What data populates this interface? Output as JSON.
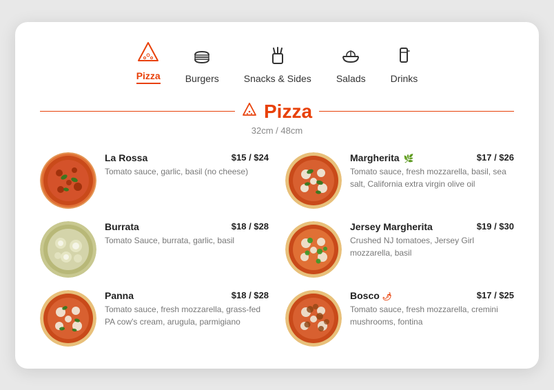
{
  "nav": {
    "items": [
      {
        "id": "pizza",
        "label": "Pizza",
        "icon": "pizza",
        "active": true
      },
      {
        "id": "burgers",
        "label": "Burgers",
        "icon": "burger",
        "active": false
      },
      {
        "id": "snacks",
        "label": "Snacks & Sides",
        "icon": "fries",
        "active": false
      },
      {
        "id": "salads",
        "label": "Salads",
        "icon": "salad",
        "active": false
      },
      {
        "id": "drinks",
        "label": "Drinks",
        "icon": "drink",
        "active": false
      }
    ]
  },
  "section": {
    "title": "Pizza",
    "subtitle": "32cm / 48cm"
  },
  "menu_items": [
    {
      "id": "la-rossa",
      "name": "La Rossa",
      "price": "$15 / $24",
      "desc": "Tomato sauce, garlic, basil (no cheese)",
      "badge": "",
      "col": 0
    },
    {
      "id": "margherita",
      "name": "Margherita",
      "price": "$17 / $26",
      "desc": "Tomato sauce, fresh mozzarella, basil, sea salt, California extra virgin olive oil",
      "badge": "veg",
      "col": 1
    },
    {
      "id": "burrata",
      "name": "Burrata",
      "price": "$18 / $28",
      "desc": "Tomato Sauce, burrata, garlic, basil",
      "badge": "",
      "col": 0
    },
    {
      "id": "jersey-margherita",
      "name": "Jersey Margherita",
      "price": "$19 / $30",
      "desc": "Crushed NJ tomatoes, Jersey Girl mozzarella, basil",
      "badge": "",
      "col": 1
    },
    {
      "id": "panna",
      "name": "Panna",
      "price": "$18 / $28",
      "desc": "Tomato sauce, fresh mozzarella, grass-fed PA cow's cream, arugula, parmigiano",
      "badge": "",
      "col": 0
    },
    {
      "id": "bosco",
      "name": "Bosco",
      "price": "$17 / $25",
      "desc": "Tomato sauce, fresh mozzarella, cremini mushrooms, fontina",
      "badge": "spicy",
      "col": 1
    }
  ],
  "pizza_colors": {
    "la-rossa": [
      "#c94a1a",
      "#e07035",
      "#8B2500",
      "#d4522a",
      "#f5c06b",
      "#2d7a1e",
      "#f0e040"
    ],
    "margherita": [
      "#c94a1a",
      "#e5e5c5",
      "#f0f0d0",
      "#2d7a1e",
      "#e07035",
      "#f5c06b"
    ],
    "burrata": [
      "#d4d4aa",
      "#c8c890",
      "#b8b878",
      "#e5e5c5",
      "#8B8B50",
      "#a0a060"
    ],
    "jersey-margherita": [
      "#c94a1a",
      "#e5e5c5",
      "#2d7a1e",
      "#3a9a28",
      "#e07035",
      "#f5c06b"
    ],
    "panna": [
      "#c94a1a",
      "#e07035",
      "#f5f5e0",
      "#f0d090",
      "#2d7a1e",
      "#d0a040"
    ],
    "bosco": [
      "#c94a1a",
      "#e07035",
      "#e5e5c5",
      "#8B4513",
      "#9a6028",
      "#f5c06b"
    ]
  }
}
